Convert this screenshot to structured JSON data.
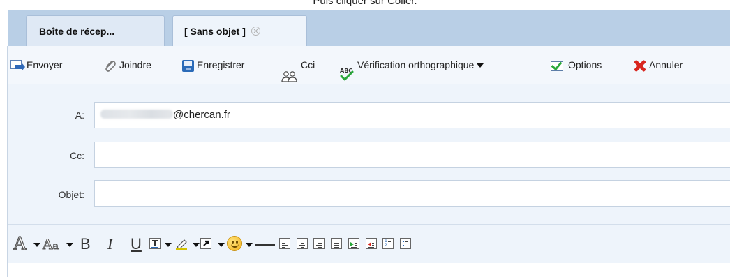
{
  "caption": "Puis cliquer sur Coller.",
  "tabs": [
    {
      "label": "Boîte de récep...",
      "active": false
    },
    {
      "label": "[ Sans objet ]",
      "active": true
    }
  ],
  "actions": {
    "send": "Envoyer",
    "attach": "Joindre",
    "save": "Enregistrer",
    "bcc": "Cci",
    "spellcheck": "Vérification orthographique",
    "options": "Options",
    "cancel": "Annuler"
  },
  "form": {
    "to_label": "A:",
    "to_value": "@chercan.fr",
    "cc_label": "Cc:",
    "cc_value": "",
    "subject_label": "Objet:",
    "subject_value": ""
  },
  "format_toolbar": {
    "font_glyph": "A",
    "size_glyph": "A",
    "bold": "B",
    "italic": "I",
    "underline": "U"
  },
  "colors": {
    "tabbar_bg": "#b9cfe6",
    "toolbar_bg": "#f3f7fc",
    "form_bg": "#eef4fb",
    "cancel_red": "#d8261f",
    "send_blue": "#2e68b8"
  },
  "icons": {
    "send": "send-icon",
    "attach": "paperclip-icon",
    "save": "floppy-disk-icon",
    "bcc": "users-icon",
    "spellcheck": "abc-check-icon",
    "options": "checkbox-icon",
    "cancel": "red-x-icon"
  }
}
